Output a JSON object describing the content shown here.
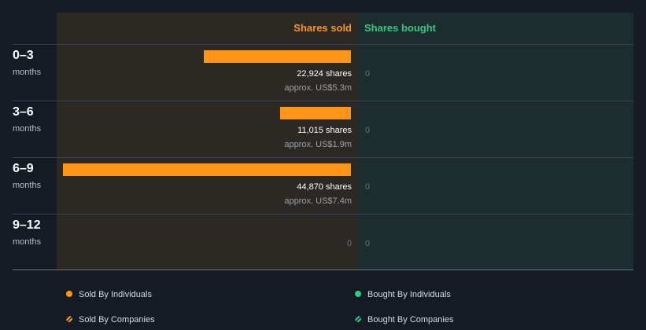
{
  "colors": {
    "sold": "#ff9416",
    "bought": "#2fcb7e"
  },
  "chart_data": {
    "type": "bar",
    "orientation": "horizontal",
    "headers": {
      "sold": "Shares sold",
      "bought": "Shares bought"
    },
    "periods": [
      {
        "range": "0–3",
        "unit": "months",
        "sold_shares": 22924,
        "sold_label": "22,924 shares",
        "sold_value": "approx. US$5.3m",
        "bought_label": "0"
      },
      {
        "range": "3–6",
        "unit": "months",
        "sold_shares": 11015,
        "sold_label": "11,015 shares",
        "sold_value": "approx. US$1.9m",
        "bought_label": "0"
      },
      {
        "range": "6–9",
        "unit": "months",
        "sold_shares": 44870,
        "sold_label": "44,870 shares",
        "sold_value": "approx. US$7.4m",
        "bought_label": "0"
      },
      {
        "range": "9–12",
        "unit": "months",
        "sold_shares": 0,
        "sold_label": "0",
        "sold_value": "",
        "bought_label": "0"
      }
    ],
    "legend": [
      {
        "label": "Sold By Individuals",
        "marker": "dot",
        "color": "#ff9416"
      },
      {
        "label": "Bought By Individuals",
        "marker": "dot",
        "color": "#2fcb7e"
      },
      {
        "label": "Sold By Companies",
        "marker": "striped-dot",
        "color": "#ff9416"
      },
      {
        "label": "Bought By Companies",
        "marker": "striped-dot",
        "color": "#2fcb7e"
      }
    ],
    "legend_position": "bottom"
  }
}
